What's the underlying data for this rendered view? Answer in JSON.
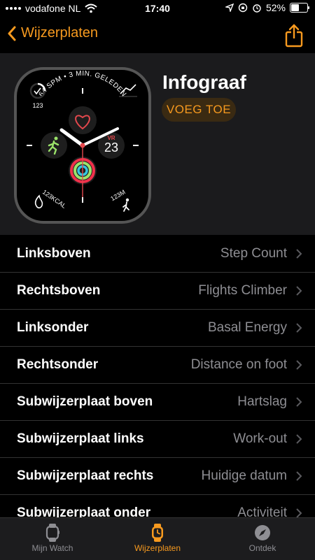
{
  "status_bar": {
    "carrier": "vodafone NL",
    "time": "17:40",
    "battery": "52%",
    "battery_level": 0.52
  },
  "nav": {
    "back_label": "Wijzerplaten",
    "share_icon": "share-icon"
  },
  "face": {
    "title": "Infograaf",
    "add_button": "VOEG TOE",
    "preview": {
      "arc_top": "64 SPM • 3 MIN. GELEDEN",
      "top_left_value": "123",
      "bottom_left": "123KCAL",
      "bottom_right": "123M",
      "date_day": "VR",
      "date_number": "23"
    }
  },
  "settings": [
    {
      "label": "Linksboven",
      "value": "Step Count"
    },
    {
      "label": "Rechtsboven",
      "value": "Flights Climber"
    },
    {
      "label": "Linksonder",
      "value": "Basal Energy"
    },
    {
      "label": "Rechtsonder",
      "value": "Distance on foot"
    },
    {
      "label": "Subwijzerplaat boven",
      "value": "Hartslag"
    },
    {
      "label": "Subwijzerplaat links",
      "value": "Work-out"
    },
    {
      "label": "Subwijzerplaat rechts",
      "value": "Huidige datum"
    },
    {
      "label": "Subwijzerplaat onder",
      "value": "Activiteit"
    }
  ],
  "tabs": [
    {
      "label": "Mijn Watch",
      "icon": "watch-icon",
      "active": false
    },
    {
      "label": "Wijzerplaten",
      "icon": "watch-faces-icon",
      "active": true
    },
    {
      "label": "Ontdek",
      "icon": "compass-icon",
      "active": false
    }
  ],
  "colors": {
    "accent": "#f79a1f",
    "background": "#000000",
    "card": "#1b1b1d",
    "secondary_text": "#8e8e93"
  }
}
